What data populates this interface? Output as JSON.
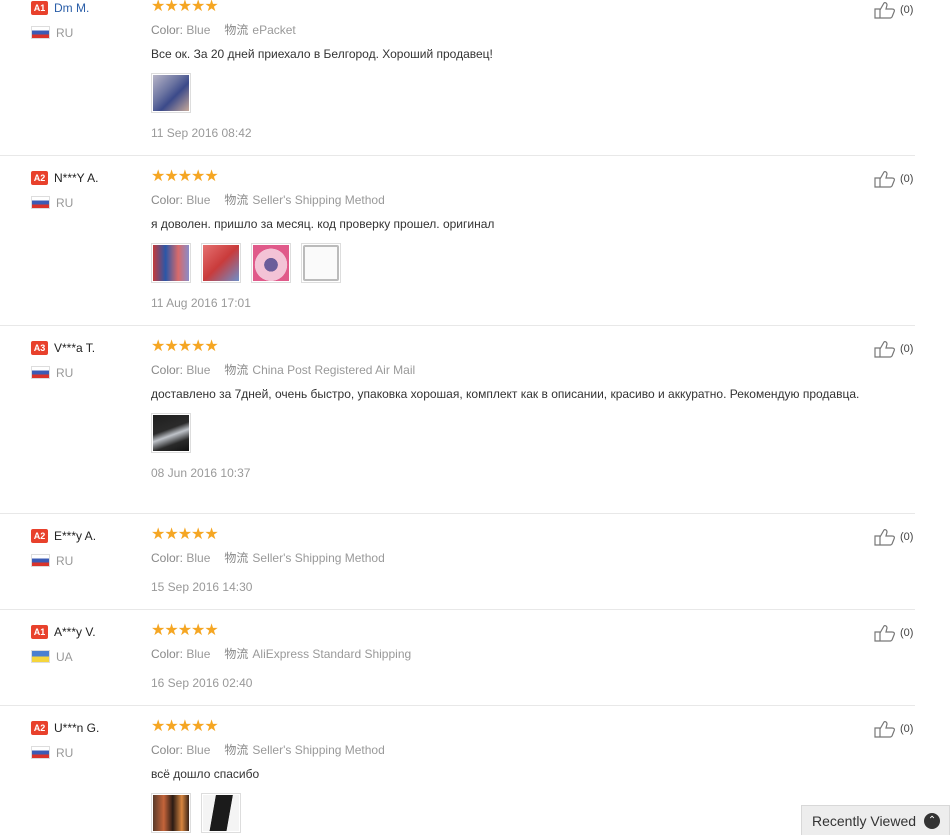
{
  "labels": {
    "color": "Color:",
    "shipping_cn": "物流"
  },
  "reviews": [
    {
      "badge": "A1",
      "name": "Dm M.",
      "country": "RU",
      "stars": "★★★★★",
      "color": "Blue",
      "shipping": "ePacket",
      "text": "Все ок. За 20 дней приехало в Белгород. Хороший продавец!",
      "photos": 1,
      "date": "11 Sep 2016 08:42",
      "helpful": "(0)"
    },
    {
      "badge": "A2",
      "name": "N***Y A.",
      "country": "RU",
      "stars": "★★★★★",
      "color": "Blue",
      "shipping": "Seller's Shipping Method",
      "text": "я доволен. пришло за месяц. код проверку прошел. оригинал",
      "photos": 4,
      "date": "11 Aug 2016 17:01",
      "helpful": "(0)"
    },
    {
      "badge": "A3",
      "name": "V***a T.",
      "country": "RU",
      "stars": "★★★★★",
      "color": "Blue",
      "shipping": "China Post Registered Air Mail",
      "text": "доставлено за 7дней, очень быстро, упаковка хорошая, комплект как в описании, красиво и аккуратно. Рекомендую продавца.",
      "photos": 1,
      "date": "08 Jun 2016 10:37",
      "helpful": "(0)"
    },
    {
      "badge": "A2",
      "name": "E***y A.",
      "country": "RU",
      "stars": "★★★★★",
      "color": "Blue",
      "shipping": "Seller's Shipping Method",
      "text": "",
      "photos": 0,
      "date": "15 Sep 2016 14:30",
      "helpful": "(0)"
    },
    {
      "badge": "A1",
      "name": "A***y V.",
      "country": "UA",
      "stars": "★★★★★",
      "color": "Blue",
      "shipping": "AliExpress Standard Shipping",
      "text": "",
      "photos": 0,
      "date": "16 Sep 2016 02:40",
      "helpful": "(0)"
    },
    {
      "badge": "A2",
      "name": "U***n G.",
      "country": "RU",
      "stars": "★★★★★",
      "color": "Blue",
      "shipping": "Seller's Shipping Method",
      "text": "всё дошло спасибо",
      "photos": 2,
      "date": "",
      "helpful": "(0)"
    }
  ],
  "recently_viewed": {
    "label": "Recently Viewed",
    "icon": "chevron-up-icon"
  }
}
